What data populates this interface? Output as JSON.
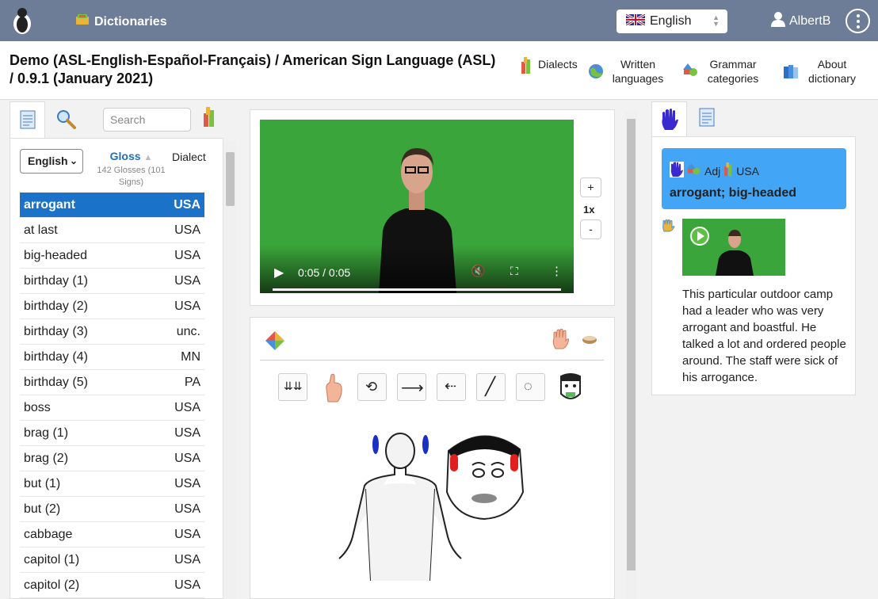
{
  "topbar": {
    "dictionaries_label": "Dictionaries",
    "language": "English",
    "user": "AlbertB"
  },
  "header": {
    "title": "Demo (ASL-English-Español-Français) / American Sign Language (ASL) / 0.9.1 (January 2021)",
    "buttons": [
      "Dialects",
      "Written languages",
      "Grammar categories",
      "About dictionary"
    ]
  },
  "left": {
    "search_placeholder": "Search",
    "language_dropdown": "English",
    "gloss_header": "Gloss",
    "gloss_count": "142 Glosses (101 Signs)",
    "dialect_header": "Dialect",
    "rows": [
      {
        "gloss": "arrogant",
        "dialect": "USA"
      },
      {
        "gloss": "at last",
        "dialect": "USA"
      },
      {
        "gloss": "big-headed",
        "dialect": "USA"
      },
      {
        "gloss": "birthday (1)",
        "dialect": "USA"
      },
      {
        "gloss": "birthday (2)",
        "dialect": "USA"
      },
      {
        "gloss": "birthday (3)",
        "dialect": "unc."
      },
      {
        "gloss": "birthday (4)",
        "dialect": "MN"
      },
      {
        "gloss": "birthday (5)",
        "dialect": "PA"
      },
      {
        "gloss": "boss",
        "dialect": "USA"
      },
      {
        "gloss": "brag (1)",
        "dialect": "USA"
      },
      {
        "gloss": "brag (2)",
        "dialect": "USA"
      },
      {
        "gloss": "but (1)",
        "dialect": "USA"
      },
      {
        "gloss": "but (2)",
        "dialect": "USA"
      },
      {
        "gloss": "cabbage",
        "dialect": "USA"
      },
      {
        "gloss": "capitol (1)",
        "dialect": "USA"
      },
      {
        "gloss": "capitol (2)",
        "dialect": "USA"
      }
    ]
  },
  "video": {
    "time": "0:05 / 0:05",
    "zoom_in": "+",
    "zoom_level": "1x",
    "zoom_out": "-",
    "progress": 1.0
  },
  "right": {
    "entry_category": "Adj",
    "entry_dialect": "USA",
    "entry_title": "arrogant; big-headed",
    "example_text": "This particular outdoor camp had a leader who was very arrogant and boastful. He talked a lot and ordered people around. The staff were sick of his arrogance."
  },
  "colors": {
    "topbar": "#6d7d98",
    "selected_row": "#1a73c8",
    "entry_card": "#42a5f5",
    "video_green": "#3aa53a"
  }
}
